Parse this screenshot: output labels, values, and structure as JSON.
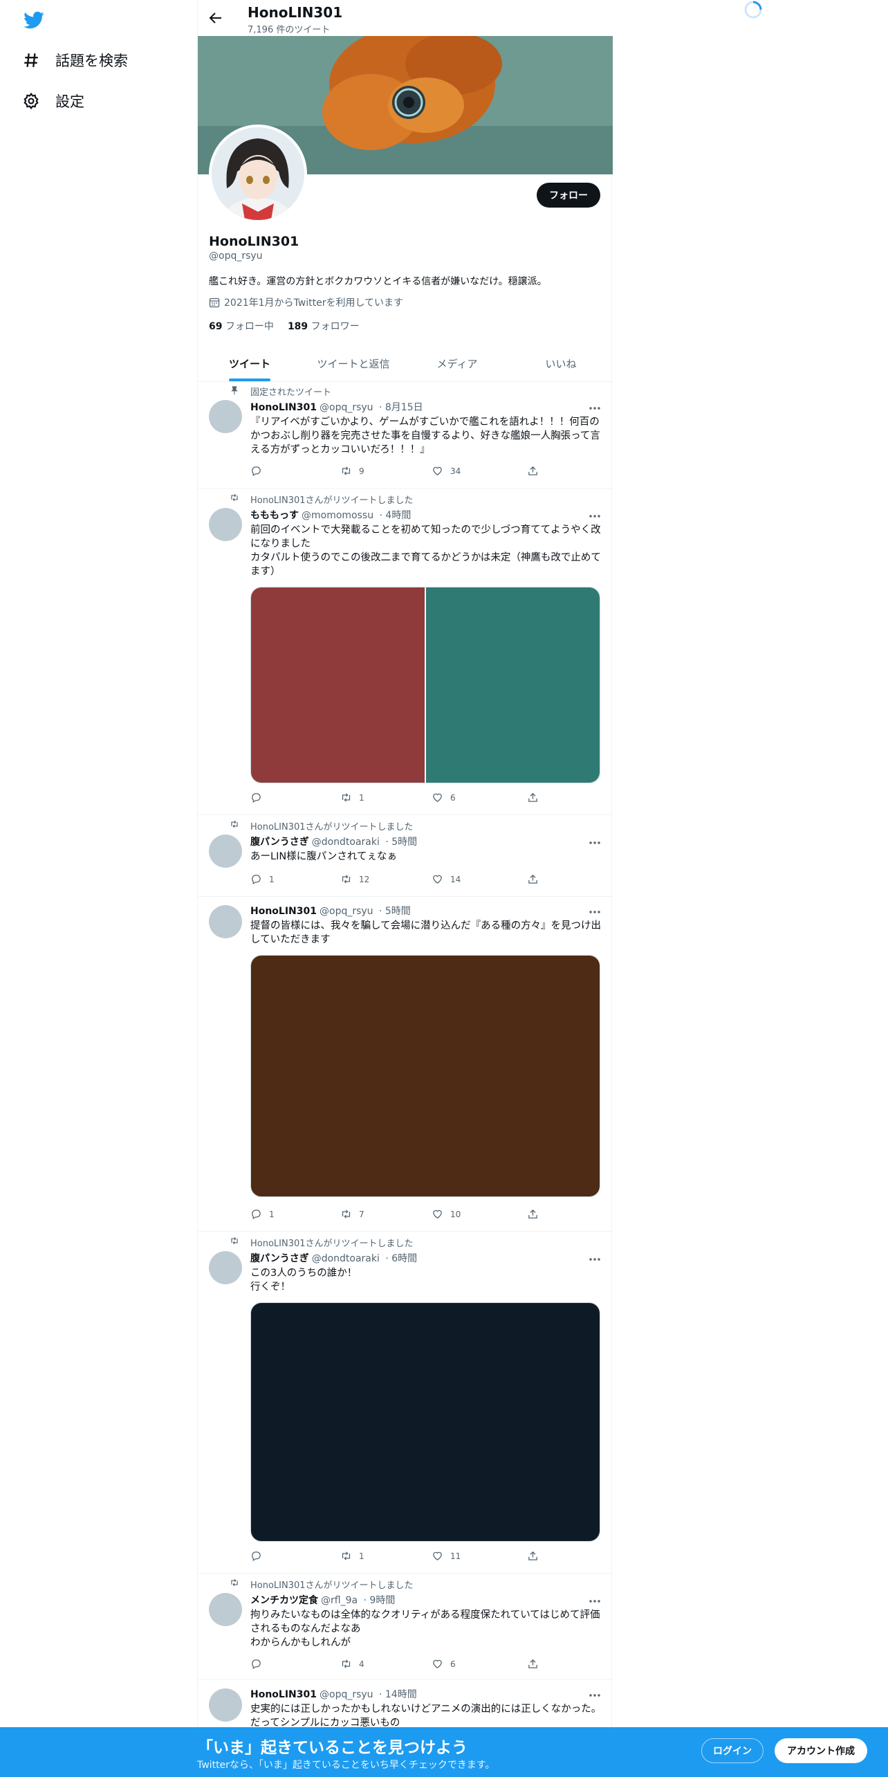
{
  "nav": {
    "items": [
      {
        "label": "話題を検索",
        "icon": "hashtag-icon"
      },
      {
        "label": "設定",
        "icon": "gear-icon"
      }
    ]
  },
  "header": {
    "name": "HonoLIN301",
    "tweet_count": "7,196 件のツイート"
  },
  "profile": {
    "follow_label": "フォロー",
    "name": "HonoLIN301",
    "handle": "@opq_rsyu",
    "bio": "艦これ好き。運営の方針とボクカワウソとイキる信者が嫌いなだけ。穏譲派。",
    "joined": "2021年1月からTwitterを利用しています",
    "following_count": "69",
    "following_label": "フォロー中",
    "followers_count": "189",
    "followers_label": "フォロワー"
  },
  "tabs": [
    "ツイート",
    "ツイートと返信",
    "メディア",
    "いいね"
  ],
  "tweets": [
    {
      "context": "固定されたツイート",
      "name": "HonoLIN301",
      "handle": "@opq_rsyu",
      "time": "· 8月15日",
      "text": "『リアイベがすごいかより、ゲームがすごいかで艦これを語れよ！！！何百のかつおぶし削り器を完売させた事を自慢するより、好きな艦娘一人胸張って言える方がずっとカッコいいだろ！！！』",
      "reply": "",
      "retweet": "9",
      "like": "34"
    },
    {
      "context": "HonoLIN301さんがリツイートしました",
      "name": "もももっす",
      "handle": "@momomossu",
      "time": "· 4時間",
      "text": "前回のイベントで大発載ることを初めて知ったので少しづつ育ててようやく改になりました\nカタパルト使うのでこの後改二まで育てるかどうかは未定（神鷹も改で止めてます）",
      "reply": "",
      "retweet": "1",
      "like": "6"
    },
    {
      "context": "HonoLIN301さんがリツイートしました",
      "name": "腹パンうさぎ",
      "handle": "@dondtoaraki",
      "time": "· 5時間",
      "text": "あーLIN様に腹パンされてぇなぁ",
      "reply": "1",
      "retweet": "12",
      "like": "14"
    },
    {
      "context": "",
      "name": "HonoLIN301",
      "handle": "@opq_rsyu",
      "time": "· 5時間",
      "text": "提督の皆様には、我々を騙して会場に潜り込んだ『ある種の方々』を見つけ出していただきます",
      "reply": "1",
      "retweet": "7",
      "like": "10"
    },
    {
      "context": "HonoLIN301さんがリツイートしました",
      "name": "腹パンうさぎ",
      "handle": "@dondtoaraki",
      "time": "· 6時間",
      "text": "この3人のうちの誰か！\n行くぞ！",
      "reply": "",
      "retweet": "1",
      "like": "11"
    },
    {
      "context": "HonoLIN301さんがリツイートしました",
      "name": "メンチカツ定食",
      "handle": "@rfl_9a",
      "time": "· 9時間",
      "text": "拘りみたいなものは全体的なクオリティがある程度保たれていてはじめて評価されるものなんだよなあ\nわからんかもしれんが",
      "reply": "",
      "retweet": "4",
      "like": "6"
    },
    {
      "context": "",
      "name": "HonoLIN301",
      "handle": "@opq_rsyu",
      "time": "· 14時間",
      "text": "史実的には正しかったかもしれないけどアニメの演出的には正しくなかった。だってシンプルにカッコ悪いもの",
      "reply": "",
      "retweet": "",
      "like": ""
    }
  ],
  "bottom": {
    "title": "「いま」起きていることを見つけよう",
    "subtitle": "Twitterなら、「いま」起きていることをいち早くチェックできます。",
    "login": "ログイン",
    "signup": "アカウント作成"
  },
  "colors": {
    "accent": "#1d9bf0",
    "media_left": "#8f3b3c",
    "media_right": "#2f7a72",
    "media_brown": "#4d2b14",
    "media_navy": "#0e1b27"
  }
}
